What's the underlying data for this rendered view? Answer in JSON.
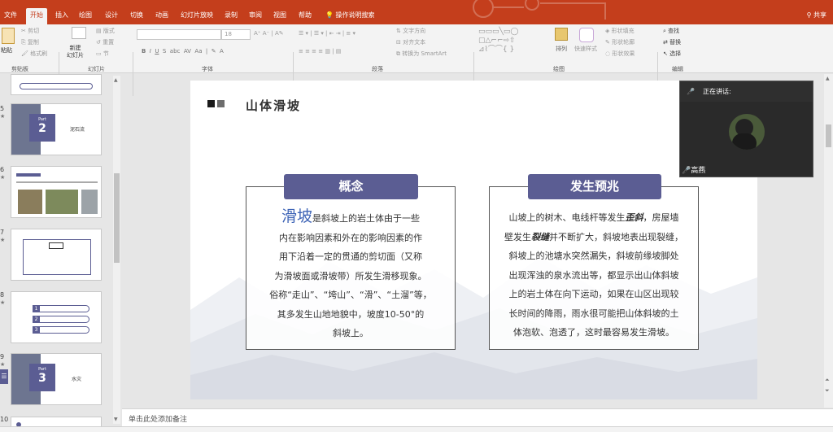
{
  "ribbon_tabs": [
    "文件",
    "开始",
    "插入",
    "绘图",
    "设计",
    "切换",
    "动画",
    "幻灯片放映",
    "录制",
    "审阅",
    "视图",
    "帮助"
  ],
  "tell_me": "操作说明搜索",
  "share": "共享",
  "ribbon": {
    "paste": "粘贴",
    "cut": "剪切",
    "copy": "复制",
    "format_painter": "格式刷",
    "new_slide": "新建\n幻灯片",
    "layout": "版式",
    "reset": "重置",
    "section": "节",
    "font_size": "18",
    "text_direction": "文字方向",
    "align_text": "对齐文本",
    "convert_smartart": "转换为 SmartArt",
    "arrange": "排列",
    "quick_styles": "快速样式",
    "shape_fill": "形状填充",
    "shape_outline": "形状轮廓",
    "shape_effects": "形状效果",
    "find": "查找",
    "replace": "替换",
    "select": "选择",
    "groups": {
      "clipboard": "剪贴板",
      "slides": "幻灯片",
      "font": "字体",
      "paragraph": "段落",
      "drawing": "绘图",
      "editing": "编辑"
    }
  },
  "thumbnails": [
    {
      "num": "5",
      "kind": "section",
      "part_label": "Part",
      "part_num": "2",
      "title": "泥石流"
    },
    {
      "num": "6",
      "kind": "photos"
    },
    {
      "num": "7",
      "kind": "diagram"
    },
    {
      "num": "8",
      "kind": "list",
      "items": [
        "1",
        "2",
        "3"
      ]
    },
    {
      "num": "9",
      "kind": "section",
      "part_label": "Part",
      "part_num": "3",
      "title": "水灾"
    },
    {
      "num": "10",
      "kind": "partial"
    }
  ],
  "slide": {
    "title": "山体滑坡",
    "left": {
      "header": "概念",
      "highlight": "滑坡",
      "first_line_rest": "是斜坡上的岩土体由于一些",
      "lines": [
        "内在影响因素和外在的影响因素的作",
        "用下沿着一定的贯通的剪切面（又称",
        "为滑坡面或滑坡带）所发生滑移现象。",
        "俗称“走山”、“垮山”、“滑”、“土溜”等，",
        "其多发生山地地貌中，坡度10-50°的",
        "斜坡上。"
      ]
    },
    "right": {
      "header": "发生预兆",
      "line1_a": "山坡上的树木、电线杆等发生",
      "line1_b": "歪斜",
      "line1_c": "，房屋墙",
      "line2_a": "壁发生",
      "line2_b": "裂缝",
      "line2_c": "并不断扩大，斜坡地表出现裂缝，",
      "lines": [
        "斜坡上的池塘水突然漏失，斜坡前缘坡脚处",
        "出现浑浊的泉水流出等，都显示出山体斜坡",
        "上的岩土体在向下运动，如果在山区出现较",
        "长时间的降雨，雨水很可能把山体斜坡的土",
        "体泡软、泡透了，这时最容易发生滑坡。"
      ]
    }
  },
  "video": {
    "speaking_label": "正在讲话:",
    "speaker_name": "高燕"
  },
  "notes_placeholder": "单击此处添加备注",
  "colors": {
    "accent": "#c43e1c",
    "pill": "#5b5d93",
    "highlight": "#3e64b6"
  }
}
